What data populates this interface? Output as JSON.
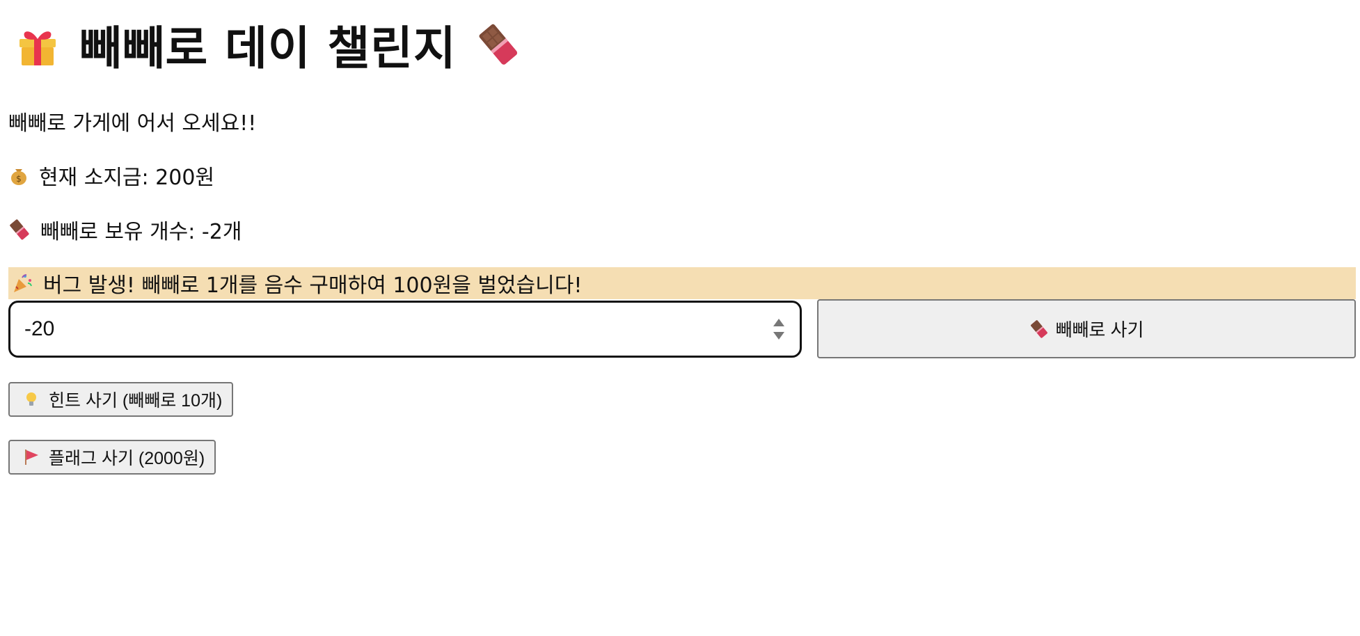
{
  "header": {
    "title": "빼빼로 데이 챌린지",
    "title_icon_left": "gift-icon",
    "title_icon_right": "chocolate-bar-icon"
  },
  "welcome": {
    "text": "빼빼로 가게에 어서 오세요!!"
  },
  "status": {
    "money_icon": "money-bag-icon",
    "money_text": "현재 소지금: 200원",
    "count_icon": "chocolate-bar-icon",
    "count_text": "빼빼로 보유 개수: -2개"
  },
  "banner": {
    "icon": "party-popper-icon",
    "text": "버그 발생! 빼빼로 1개를 음수 구매하여 100원을 벌었습니다!",
    "background": "#f5deb3"
  },
  "purchase": {
    "quantity_value": "-20",
    "buy_icon": "chocolate-bar-icon",
    "buy_label": "빼빼로 사기"
  },
  "actions": {
    "hint_icon": "light-bulb-icon",
    "hint_label": "힌트 사기 (빼빼로 10개)",
    "flag_icon": "red-flag-icon",
    "flag_label": "플래그 사기 (2000원)"
  }
}
